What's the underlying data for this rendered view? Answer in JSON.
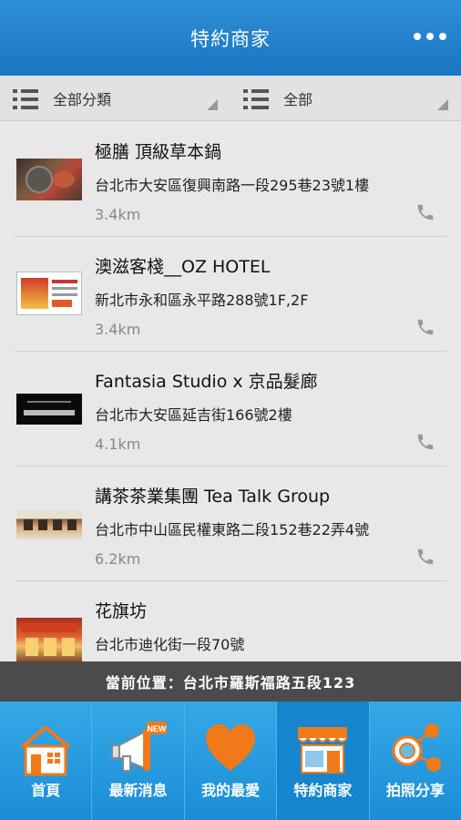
{
  "header": {
    "title": "特約商家"
  },
  "filters": [
    {
      "label": "全部分類"
    },
    {
      "label": "全部"
    }
  ],
  "stores": [
    {
      "name": "極膳 頂級草本鍋",
      "address": "台北市大安區復興南路一段295巷23號1樓",
      "distance": "3.4km"
    },
    {
      "name": "澳滋客棧__OZ HOTEL",
      "address": "新北市永和區永平路288號1F,2F",
      "distance": "3.4km"
    },
    {
      "name": "Fantasia Studio x 京品髮廊",
      "address": "台北市大安區延吉街166號2樓",
      "distance": "4.1km"
    },
    {
      "name": "講茶茶業集團 Tea Talk Group",
      "address": "台北市中山區民權東路二段152巷22弄4號",
      "distance": "6.2km"
    },
    {
      "name": "花旗坊",
      "address": "台北市迪化街一段70號",
      "distance": ""
    }
  ],
  "location": {
    "text": "當前位置：台北市羅斯福路五段123"
  },
  "tabs": [
    {
      "label": "首頁",
      "icon": "home-icon"
    },
    {
      "label": "最新消息",
      "icon": "megaphone-icon",
      "badge": "NEW"
    },
    {
      "label": "我的最愛",
      "icon": "heart-icon"
    },
    {
      "label": "特約商家",
      "icon": "store-icon"
    },
    {
      "label": "拍照分享",
      "icon": "share-icon"
    }
  ],
  "colors": {
    "header": "#1a75c2",
    "tabbar": "#1b8dd8",
    "active_tab": "#1586cd",
    "heart": "#f07a1a",
    "location_bar": "#4b4b4b"
  }
}
